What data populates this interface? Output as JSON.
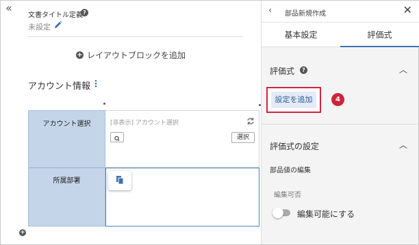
{
  "left": {
    "collapse_icon": "double-chevron-left-icon",
    "doc_title_label": "文書タイトル定義",
    "doc_title_value": "未設定",
    "add_block": "レイアウトブロックを追加",
    "section_title": "アカウント情報",
    "table": {
      "rows": [
        {
          "header": "アカウント選択",
          "value": "[非表示] アカウント選択",
          "select_label": "選択"
        },
        {
          "header": "所属部署"
        }
      ]
    }
  },
  "right": {
    "title": "部品新規作成",
    "tabs": [
      {
        "label": "基本設定",
        "active": false
      },
      {
        "label": "評価式",
        "active": true
      }
    ],
    "section1_title": "評価式",
    "add_setting": "設定を追加",
    "step_badge": "4",
    "section2_title": "評価式の設定",
    "sub_title": "部品値の編集",
    "editable_label": "編集可否",
    "toggle_label": "編集可能にする"
  },
  "colors": {
    "accent": "#3b6fb5",
    "highlight": "#d0233b",
    "table_header": "#c5d5e9"
  }
}
